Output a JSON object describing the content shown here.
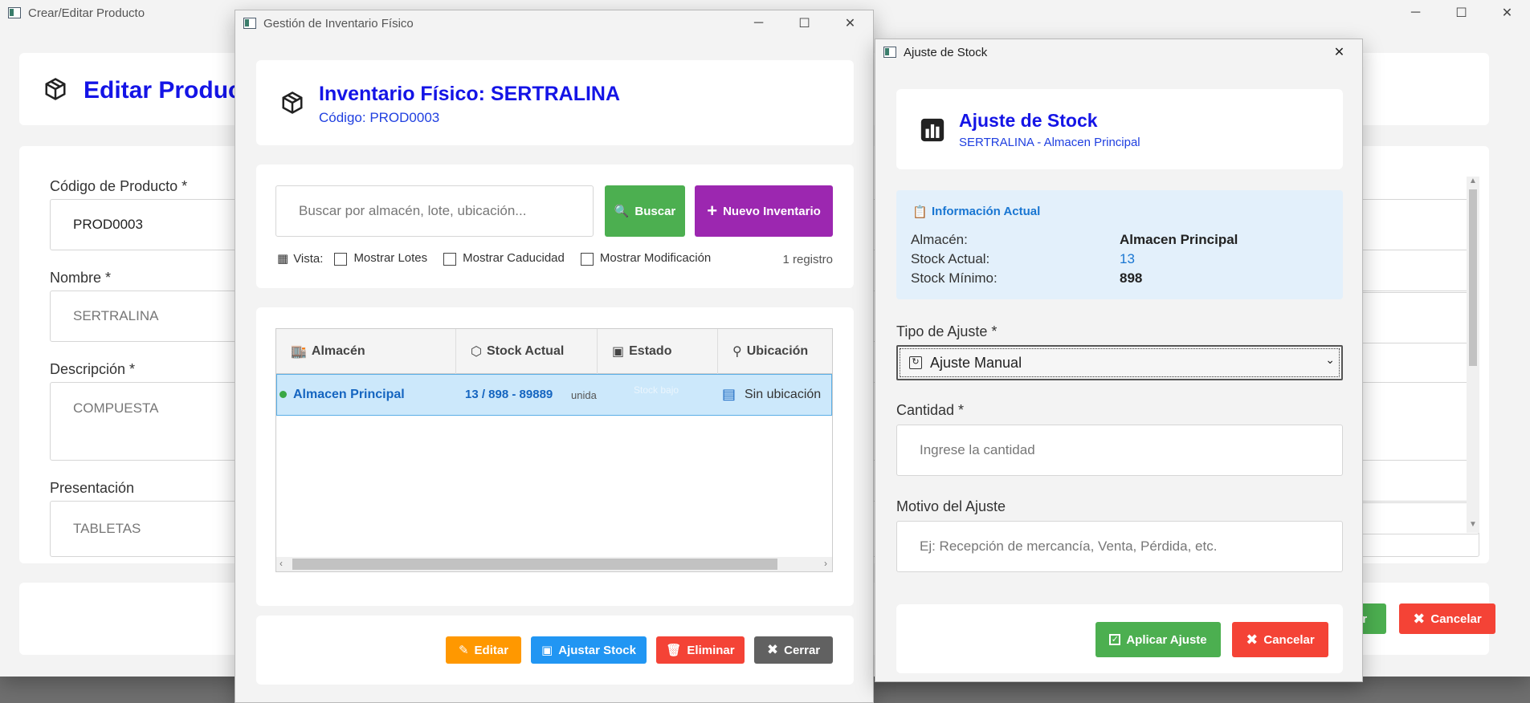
{
  "product_window": {
    "title": "Crear/Editar Producto",
    "heading": "Editar Producto",
    "code_label": "Código de Producto *",
    "code_value": "PROD0003",
    "name_label": "Nombre *",
    "name_value": "SERTRALINA",
    "desc_label": "Descripción *",
    "desc_value": "COMPUESTA",
    "pres_label": "Presentación",
    "pres_value": "TABLETAS",
    "save_partial": "ar",
    "cancel_label": "Cancelar"
  },
  "inventory_window": {
    "title": "Gestión de Inventario Físico",
    "heading": "Inventario Físico: SERTRALINA",
    "subheading": "Código: PROD0003",
    "search_placeholder": "Buscar por almacén, lote, ubicación...",
    "search_button": "Buscar",
    "new_button": "Nuevo Inventario",
    "view_label": "Vista:",
    "show_lots": "Mostrar Lotes",
    "show_expiry": "Mostrar Caducidad",
    "show_modification": "Mostrar Modificación",
    "record_count": "1 registro",
    "columns": [
      "Almacén",
      "Stock Actual",
      "Estado",
      "Ubicación"
    ],
    "row": {
      "warehouse": "Almacen Principal",
      "stock": "13 / 898 - 89889",
      "unit": "unida",
      "status": "Stock bajo",
      "location": "Sin ubicación"
    },
    "edit_button": "Editar",
    "adjust_button": "Ajustar Stock",
    "delete_button": "Eliminar",
    "close_button": "Cerrar"
  },
  "adjust_window": {
    "title": "Ajuste de Stock",
    "heading": "Ajuste de Stock",
    "subheading": "SERTRALINA - Almacen Principal",
    "info_title": "Información Actual",
    "warehouse_label": "Almacén:",
    "warehouse_value": "Almacen Principal",
    "stock_label": "Stock Actual:",
    "stock_value": "13",
    "min_label": "Stock Mínimo:",
    "min_value": "898",
    "type_label": "Tipo de Ajuste *",
    "type_value": "Ajuste Manual",
    "qty_label": "Cantidad *",
    "qty_placeholder": "Ingrese la cantidad",
    "reason_label": "Motivo del Ajuste",
    "reason_placeholder": "Ej: Recepción de mercancía, Venta, Pérdida, etc.",
    "apply_button": "Aplicar Ajuste",
    "cancel_button": "Cancelar"
  },
  "colors": {
    "heading_blue": "#1414e6",
    "green": "#4caf50",
    "purple": "#9c27b0",
    "orange": "#ff9800",
    "blue": "#2196f3",
    "red": "#f44336",
    "gray": "#616161",
    "info_bg": "#e3f0fb",
    "row_selected": "#cce8fb"
  }
}
